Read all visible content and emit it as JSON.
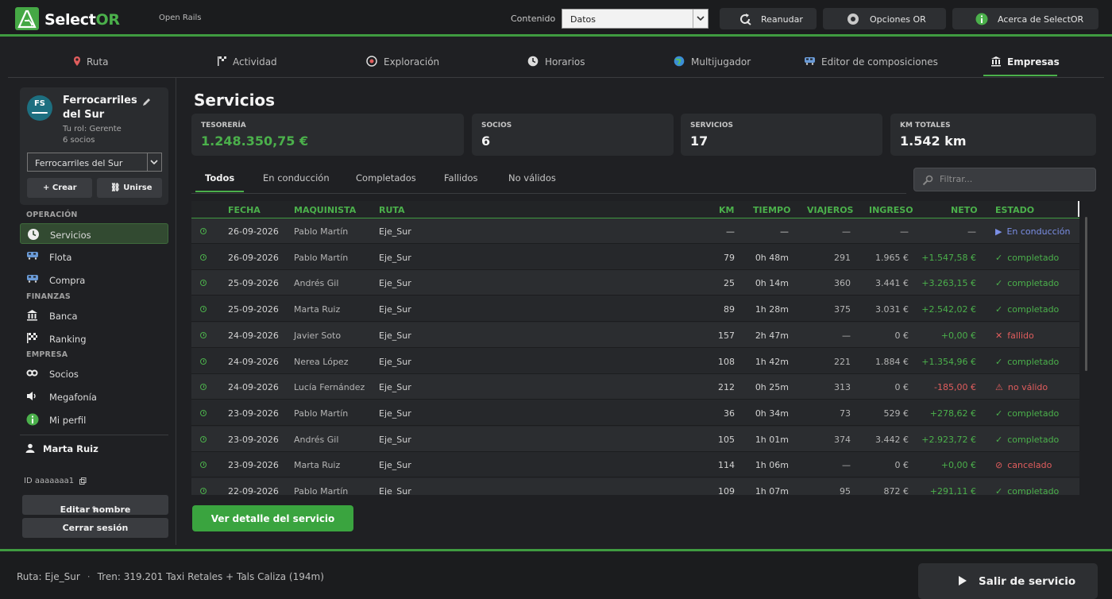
{
  "app": {
    "brand_a": "Select",
    "brand_b": "OR",
    "subtitle": "Open Rails",
    "accent": "#4bb04b"
  },
  "topbar": {
    "content_label": "Contenido",
    "content_value": "Datos",
    "buttons": [
      {
        "label": "Reanudar",
        "icon": "resume-icon"
      },
      {
        "label": "Opciones OR",
        "icon": "gear-icon"
      },
      {
        "label": "Acerca de SelectOR",
        "icon": "info-icon"
      }
    ]
  },
  "tabs": [
    {
      "label": "Ruta",
      "icon": "map-pin-icon"
    },
    {
      "label": "Actividad",
      "icon": "flag-icon"
    },
    {
      "label": "Exploración",
      "icon": "compass-icon"
    },
    {
      "label": "Horarios",
      "icon": "clock-icon"
    },
    {
      "label": "Multijugador",
      "icon": "globe-icon"
    },
    {
      "label": "Editor de composiciones",
      "icon": "train-icon"
    },
    {
      "label": "Empresas",
      "icon": "building-icon",
      "active": true
    }
  ],
  "company": {
    "initials": "FS",
    "name": "Ferrocarriles del Sur",
    "role": "Tu rol: Gerente",
    "members": "6 socios",
    "selected": "Ferrocarriles del Sur",
    "create": "Crear",
    "join": "Unirse"
  },
  "sidebar": {
    "sections": [
      "OPERACIÓN",
      "FINANZAS",
      "EMPRESA"
    ],
    "items": [
      {
        "label": "Servicios",
        "icon": "clock-icon",
        "active": true
      },
      {
        "label": "Flota",
        "icon": "train-icon"
      },
      {
        "label": "Compra",
        "icon": "train-icon"
      },
      {
        "label": "Banca",
        "icon": "bank-icon"
      },
      {
        "label": "Ranking",
        "icon": "checkered-flag-icon"
      },
      {
        "label": "Socios",
        "icon": "link-icon"
      },
      {
        "label": "Megafonía",
        "icon": "speaker-icon"
      },
      {
        "label": "Mi perfil",
        "icon": "info-icon"
      }
    ],
    "user": "Marta Ruiz",
    "user_id": "ID aaaaaaa1",
    "edit_name": "Editar nombre",
    "logout": "Cerrar sesión"
  },
  "main": {
    "title": "Servicios",
    "stats": [
      {
        "key": "TESORERÍA",
        "value": "1.248.350,75 €"
      },
      {
        "key": "SOCIOS",
        "value": "6"
      },
      {
        "key": "SERVICIOS",
        "value": "17"
      },
      {
        "key": "KM TOTALES",
        "value": "1.542 km"
      }
    ],
    "filters": [
      "Todos",
      "En conducción",
      "Completados",
      "Fallidos",
      "No válidos"
    ],
    "search_placeholder": "Filtrar...",
    "columns": [
      "FECHA",
      "MAQUINISTA",
      "RUTA",
      "KM",
      "TIEMPO",
      "VIAJEROS",
      "INGRESO",
      "NETO",
      "ESTADO"
    ],
    "rows": [
      {
        "fecha": "26-09-2026",
        "maquinista": "Pablo Martín",
        "ruta": "Eje_Sur",
        "km": "—",
        "tiempo": "—",
        "viajeros": "—",
        "ingreso": "—",
        "neto": "—",
        "estado": "En conducción",
        "estado_icon": "▶",
        "estado_kind": "run",
        "neto_kind": "dash"
      },
      {
        "fecha": "26-09-2026",
        "maquinista": "Pablo Martín",
        "ruta": "Eje_Sur",
        "km": "79",
        "tiempo": "0h 48m",
        "viajeros": "291",
        "ingreso": "1.965 €",
        "neto": "+1.547,58 €",
        "estado": "completado",
        "estado_icon": "✓",
        "estado_kind": "ok",
        "neto_kind": "pos"
      },
      {
        "fecha": "25-09-2026",
        "maquinista": "Andrés Gil",
        "ruta": "Eje_Sur",
        "km": "25",
        "tiempo": "0h 14m",
        "viajeros": "360",
        "ingreso": "3.441 €",
        "neto": "+3.263,15 €",
        "estado": "completado",
        "estado_icon": "✓",
        "estado_kind": "ok",
        "neto_kind": "pos"
      },
      {
        "fecha": "25-09-2026",
        "maquinista": "Marta Ruiz",
        "ruta": "Eje_Sur",
        "km": "89",
        "tiempo": "1h 28m",
        "viajeros": "375",
        "ingreso": "3.031 €",
        "neto": "+2.542,02 €",
        "estado": "completado",
        "estado_icon": "✓",
        "estado_kind": "ok",
        "neto_kind": "pos"
      },
      {
        "fecha": "24-09-2026",
        "maquinista": "Javier Soto",
        "ruta": "Eje_Sur",
        "km": "157",
        "tiempo": "2h 47m",
        "viajeros": "—",
        "ingreso": "0 €",
        "neto": "+0,00 €",
        "estado": "fallido",
        "estado_icon": "✕",
        "estado_kind": "fail",
        "neto_kind": "pos"
      },
      {
        "fecha": "24-09-2026",
        "maquinista": "Nerea López",
        "ruta": "Eje_Sur",
        "km": "108",
        "tiempo": "1h 42m",
        "viajeros": "221",
        "ingreso": "1.884 €",
        "neto": "+1.354,96 €",
        "estado": "completado",
        "estado_icon": "✓",
        "estado_kind": "ok",
        "neto_kind": "pos"
      },
      {
        "fecha": "24-09-2026",
        "maquinista": "Lucía Fernández",
        "ruta": "Eje_Sur",
        "km": "212",
        "tiempo": "0h 25m",
        "viajeros": "313",
        "ingreso": "0 €",
        "neto": "-185,00 €",
        "estado": "no válido",
        "estado_icon": "⚠",
        "estado_kind": "fail",
        "neto_kind": "neg"
      },
      {
        "fecha": "23-09-2026",
        "maquinista": "Pablo Martín",
        "ruta": "Eje_Sur",
        "km": "36",
        "tiempo": "0h 34m",
        "viajeros": "73",
        "ingreso": "529 €",
        "neto": "+278,62 €",
        "estado": "completado",
        "estado_icon": "✓",
        "estado_kind": "ok",
        "neto_kind": "pos"
      },
      {
        "fecha": "23-09-2026",
        "maquinista": "Andrés Gil",
        "ruta": "Eje_Sur",
        "km": "105",
        "tiempo": "1h 01m",
        "viajeros": "374",
        "ingreso": "3.442 €",
        "neto": "+2.923,72 €",
        "estado": "completado",
        "estado_icon": "✓",
        "estado_kind": "ok",
        "neto_kind": "pos"
      },
      {
        "fecha": "23-09-2026",
        "maquinista": "Marta Ruiz",
        "ruta": "Eje_Sur",
        "km": "114",
        "tiempo": "1h 06m",
        "viajeros": "—",
        "ingreso": "0 €",
        "neto": "+0,00 €",
        "estado": "cancelado",
        "estado_icon": "⊘",
        "estado_kind": "fail",
        "neto_kind": "pos"
      },
      {
        "fecha": "22-09-2026",
        "maquinista": "Pablo Martín",
        "ruta": "Eje_Sur",
        "km": "109",
        "tiempo": "1h 07m",
        "viajeros": "95",
        "ingreso": "872 €",
        "neto": "+291,11 €",
        "estado": "completado",
        "estado_icon": "✓",
        "estado_kind": "ok",
        "neto_kind": "pos"
      }
    ],
    "detail_button": "Ver detalle del servicio"
  },
  "footer": {
    "route": "Ruta: Eje_Sur",
    "separator": "·",
    "train": "Tren: 319.201 Taxi Retales + Tals Caliza (194m)",
    "exit": "Salir de servicio"
  }
}
